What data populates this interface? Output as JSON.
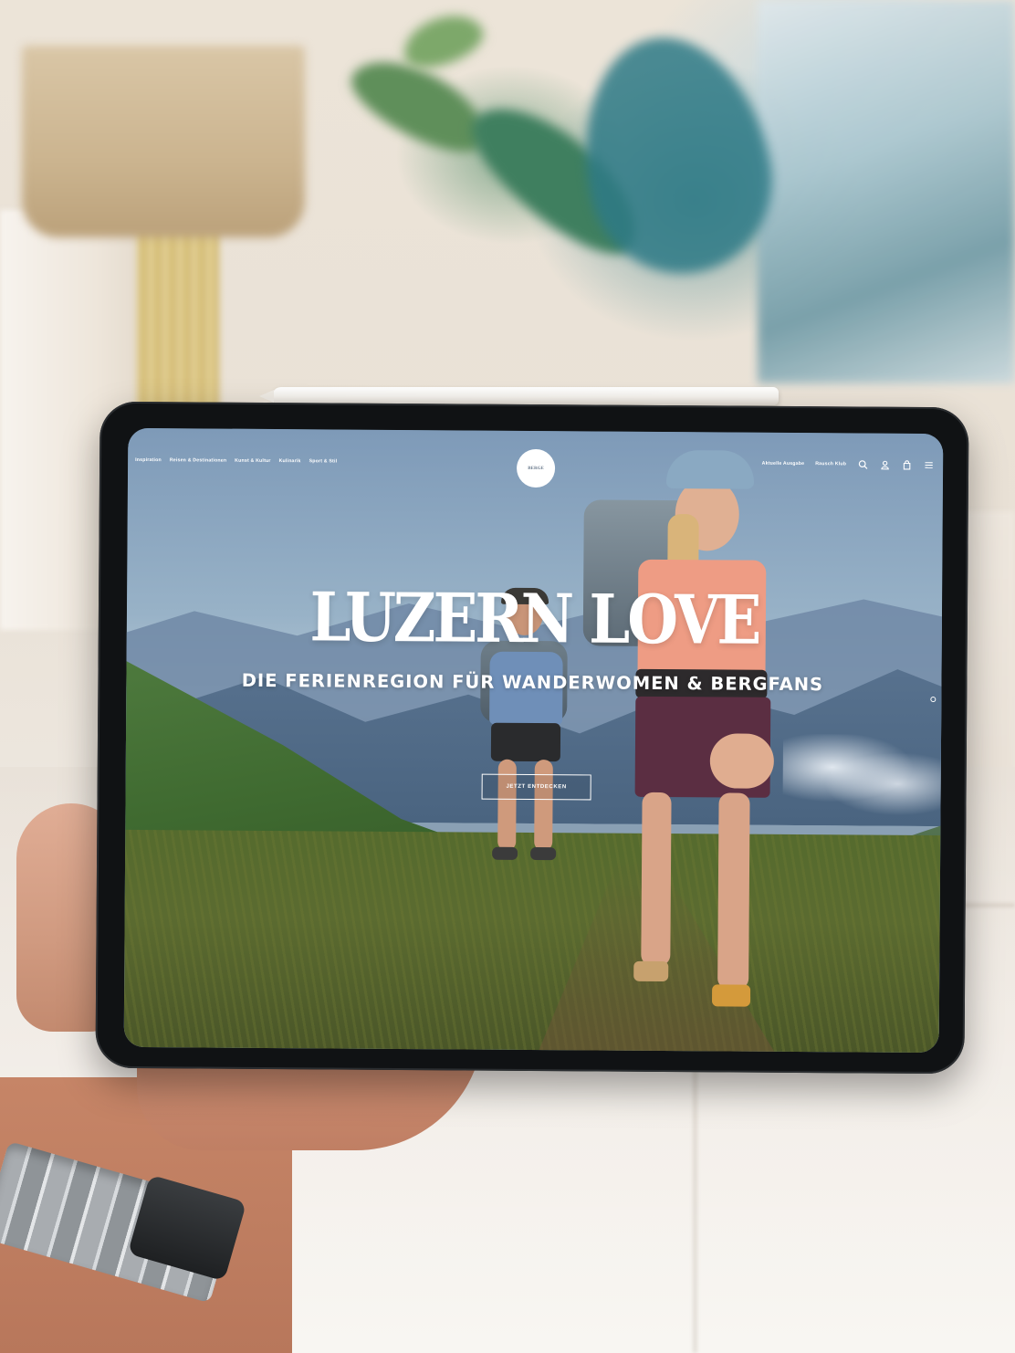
{
  "website": {
    "logo_text": "BERGE",
    "nav_left": [
      {
        "label": "Inspiration"
      },
      {
        "label": "Reisen & Destinationen"
      },
      {
        "label": "Kunst & Kultur"
      },
      {
        "label": "Kulinarik"
      },
      {
        "label": "Sport & Stil"
      }
    ],
    "nav_right": [
      {
        "label": "Aktuelle Ausgabe"
      },
      {
        "label": "Rausch Klub"
      }
    ],
    "icons": [
      "search-icon",
      "account-icon",
      "bag-icon",
      "menu-icon"
    ],
    "hero": {
      "title": "LUZERN LOVE",
      "subtitle": "DIE FERIENREGION FÜR WANDERWOMEN & BERGFANS",
      "cta_label": "JETZT ENTDECKEN"
    }
  },
  "colors": {
    "text_on_hero": "#ffffff",
    "tablet_bezel": "#101214",
    "logo_bg": "#ffffff"
  }
}
